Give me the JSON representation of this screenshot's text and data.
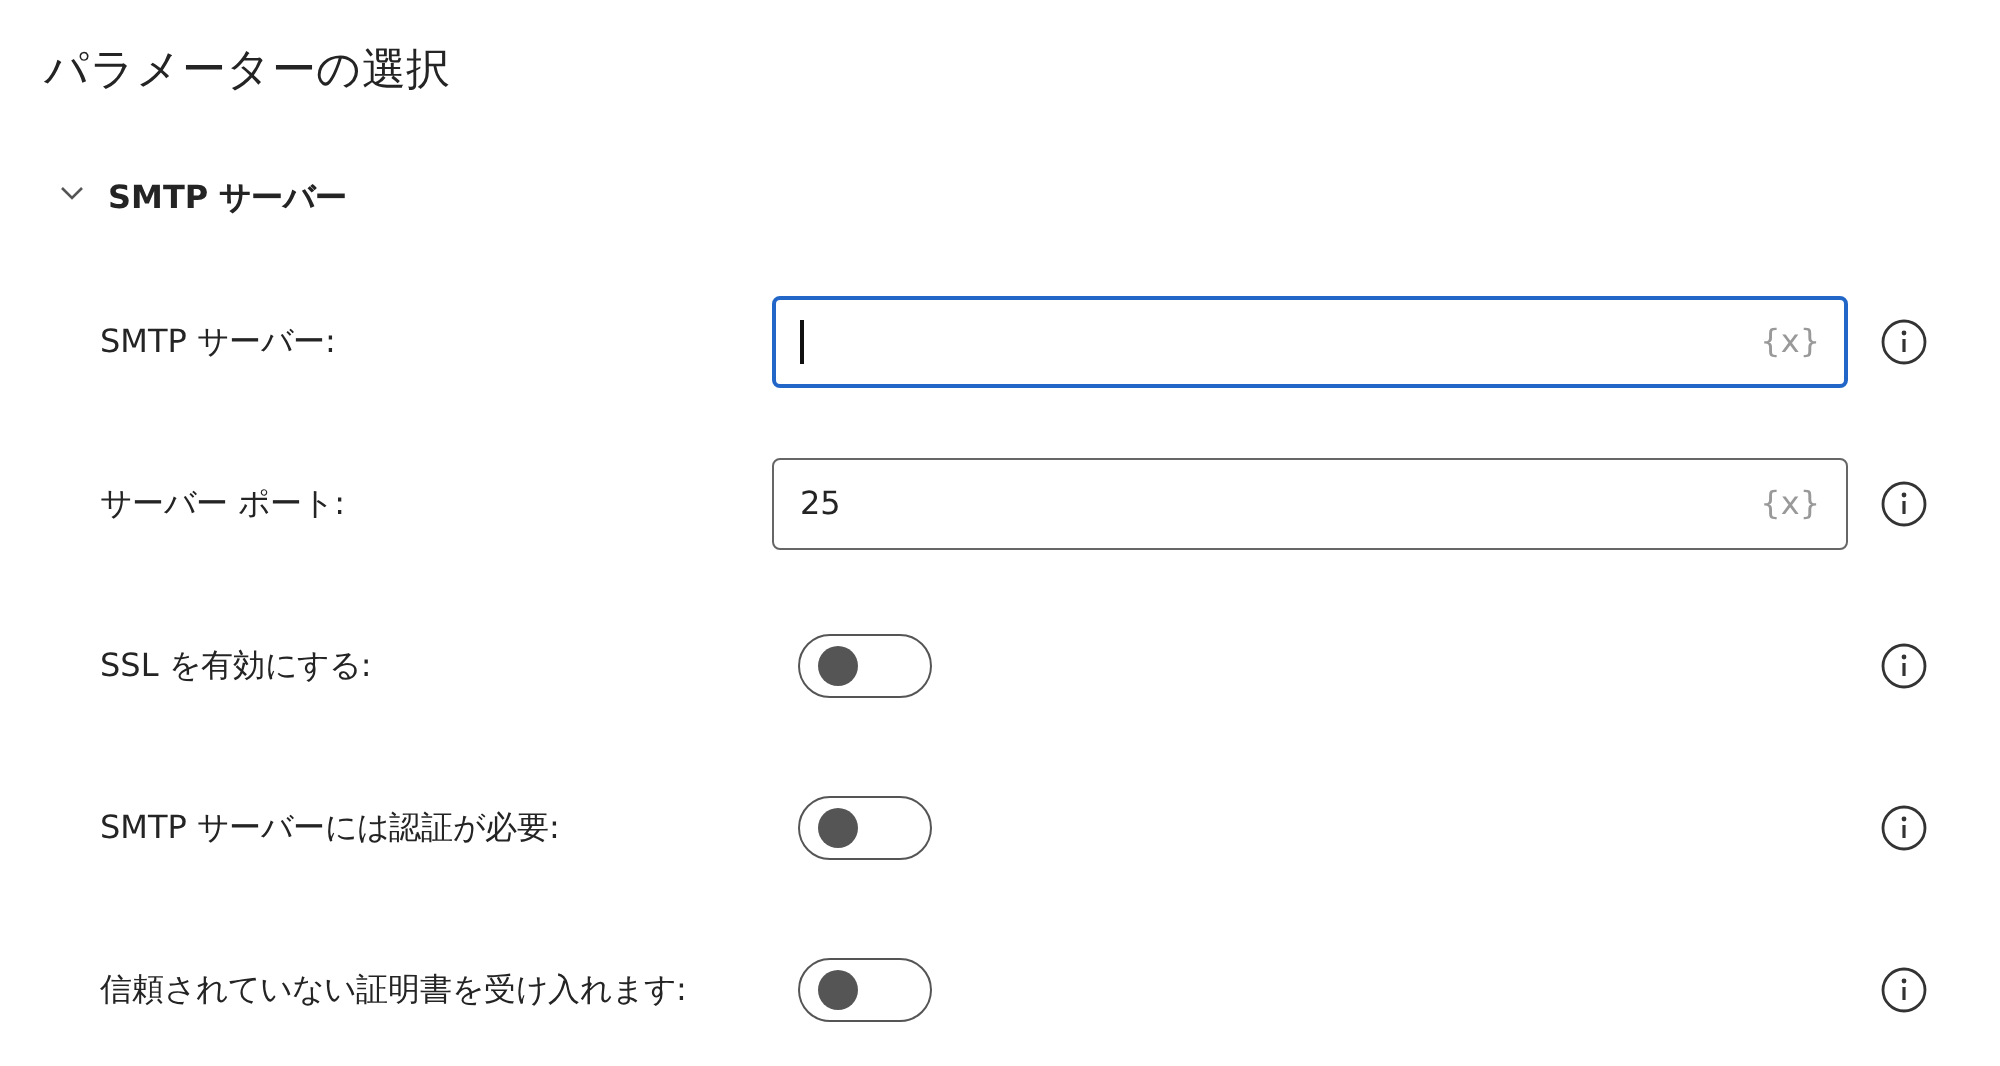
{
  "title": "パラメーターの選択",
  "section": {
    "label": "SMTP サーバー",
    "expanded": true
  },
  "params": [
    {
      "kind": "text",
      "label": "SMTP サーバー:",
      "focused": true,
      "variable_button": "{x}"
    },
    {
      "kind": "text",
      "label": "サーバー ポート:",
      "value": "25",
      "focused": false,
      "variable_button": "{x}"
    },
    {
      "kind": "toggle",
      "label": "SSL を有効にする:",
      "on": false
    },
    {
      "kind": "toggle",
      "label": "SMTP サーバーには認証が必要:",
      "on": false
    },
    {
      "kind": "toggle",
      "label": "信頼されていない証明書を受け入れます:",
      "on": false
    }
  ]
}
